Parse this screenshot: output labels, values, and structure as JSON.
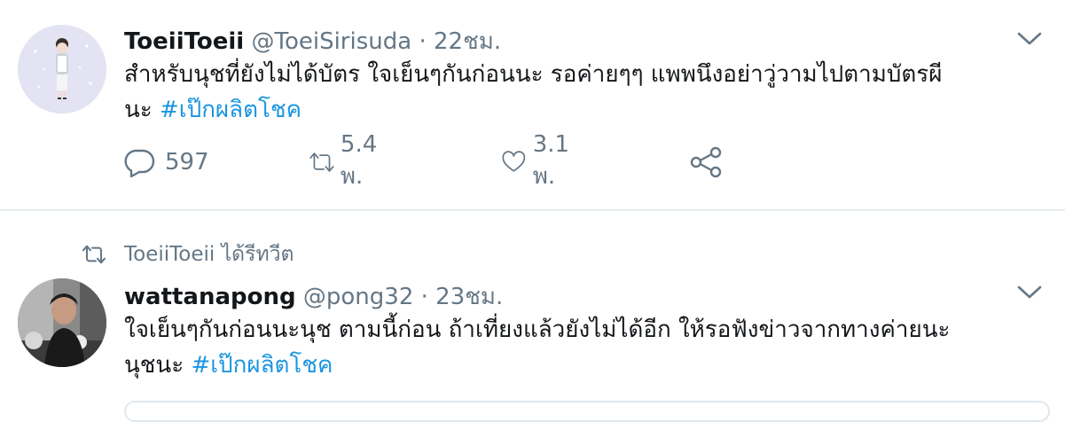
{
  "tweets": [
    {
      "display_name": "ToeiiToeii",
      "handle": "@ToeiSirisuda",
      "separator": "·",
      "time": "22ชม.",
      "text": "สำหรับนุชที่ยังไม่ได้บัตร ใจเย็นๆกันก่อนนะ รอค่ายๆๆ แพพนึงอย่าวู่วามไปตามบัตรผีนะ",
      "text_line1": "สำหรับนุชที่ยังไม่ได้บัตร ใจเย็นๆกันก่อนนะ รอค่ายๆๆ แพพนึงอย่าวู่วามไปตามบัตรผี",
      "text_line2": "นะ",
      "hashtag": "#เป๊กผลิตโชค",
      "reply_count": "597",
      "retweet_count": "5.4 พ.",
      "like_count": "3.1 พ.",
      "avatar_icon": "illustrated-girl-avatar"
    },
    {
      "retweeted_by": "ToeiiToeii ได้รีทวีต",
      "display_name": "wattanapong",
      "handle": "@pong32",
      "separator": "·",
      "time": "23ชม.",
      "text_line1": "ใจเย็นๆกันก่อนนะนุช ตามนี้ก่อน ถ้าเที่ยงแล้วยังไม่ได้อีก ให้รอฟังข่าวจากทางค่ายนะ",
      "text_line2": "นุชนะ",
      "hashtag": "#เป๊กผลิตโชค",
      "avatar_icon": "photo-avatar"
    }
  ],
  "colors": {
    "text": "#14171a",
    "secondary": "#657786",
    "link": "#1b95e0",
    "divider": "#e6ecf0"
  },
  "icons": [
    "reply-icon",
    "retweet-icon",
    "like-icon",
    "share-icon",
    "chevron-down-icon"
  ]
}
